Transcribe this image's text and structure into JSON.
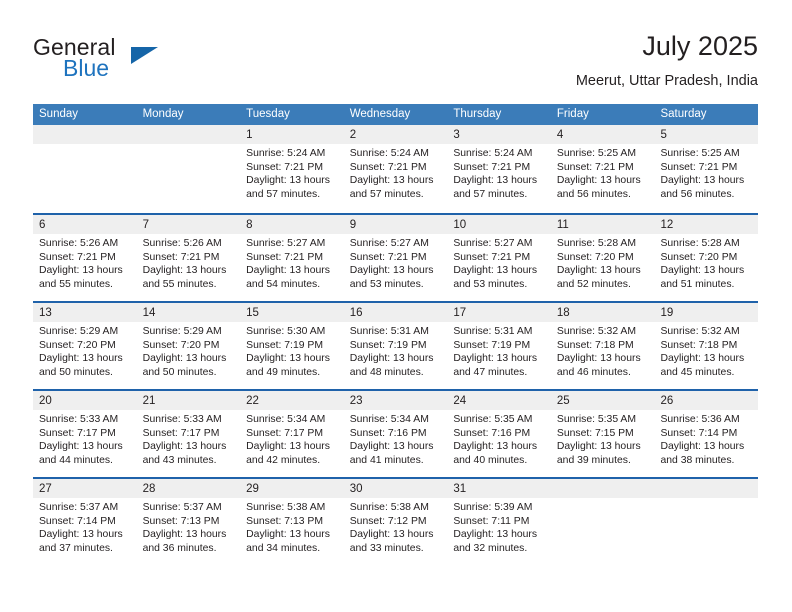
{
  "brand": {
    "name_top": "General",
    "name_bottom": "Blue",
    "triangle_icon": "brand-triangle-icon",
    "accent_color": "#1e73be"
  },
  "header": {
    "title": "July 2025",
    "subtitle": "Meerut, Uttar Pradesh, India"
  },
  "theme": {
    "header_blue": "#3b7cb9",
    "rule_blue": "#1f62aa",
    "day_band_gray": "#efefef",
    "text_color": "#231f20"
  },
  "calendar": {
    "weekdays": [
      "Sunday",
      "Monday",
      "Tuesday",
      "Wednesday",
      "Thursday",
      "Friday",
      "Saturday"
    ],
    "weeks": [
      [
        {
          "day": "",
          "sunrise": "",
          "sunset": "",
          "daylight": "",
          "empty": true
        },
        {
          "day": "",
          "sunrise": "",
          "sunset": "",
          "daylight": "",
          "empty": true
        },
        {
          "day": "1",
          "sunrise": "Sunrise: 5:24 AM",
          "sunset": "Sunset: 7:21 PM",
          "daylight": "Daylight: 13 hours and 57 minutes."
        },
        {
          "day": "2",
          "sunrise": "Sunrise: 5:24 AM",
          "sunset": "Sunset: 7:21 PM",
          "daylight": "Daylight: 13 hours and 57 minutes."
        },
        {
          "day": "3",
          "sunrise": "Sunrise: 5:24 AM",
          "sunset": "Sunset: 7:21 PM",
          "daylight": "Daylight: 13 hours and 57 minutes."
        },
        {
          "day": "4",
          "sunrise": "Sunrise: 5:25 AM",
          "sunset": "Sunset: 7:21 PM",
          "daylight": "Daylight: 13 hours and 56 minutes."
        },
        {
          "day": "5",
          "sunrise": "Sunrise: 5:25 AM",
          "sunset": "Sunset: 7:21 PM",
          "daylight": "Daylight: 13 hours and 56 minutes."
        }
      ],
      [
        {
          "day": "6",
          "sunrise": "Sunrise: 5:26 AM",
          "sunset": "Sunset: 7:21 PM",
          "daylight": "Daylight: 13 hours and 55 minutes."
        },
        {
          "day": "7",
          "sunrise": "Sunrise: 5:26 AM",
          "sunset": "Sunset: 7:21 PM",
          "daylight": "Daylight: 13 hours and 55 minutes."
        },
        {
          "day": "8",
          "sunrise": "Sunrise: 5:27 AM",
          "sunset": "Sunset: 7:21 PM",
          "daylight": "Daylight: 13 hours and 54 minutes."
        },
        {
          "day": "9",
          "sunrise": "Sunrise: 5:27 AM",
          "sunset": "Sunset: 7:21 PM",
          "daylight": "Daylight: 13 hours and 53 minutes."
        },
        {
          "day": "10",
          "sunrise": "Sunrise: 5:27 AM",
          "sunset": "Sunset: 7:21 PM",
          "daylight": "Daylight: 13 hours and 53 minutes."
        },
        {
          "day": "11",
          "sunrise": "Sunrise: 5:28 AM",
          "sunset": "Sunset: 7:20 PM",
          "daylight": "Daylight: 13 hours and 52 minutes."
        },
        {
          "day": "12",
          "sunrise": "Sunrise: 5:28 AM",
          "sunset": "Sunset: 7:20 PM",
          "daylight": "Daylight: 13 hours and 51 minutes."
        }
      ],
      [
        {
          "day": "13",
          "sunrise": "Sunrise: 5:29 AM",
          "sunset": "Sunset: 7:20 PM",
          "daylight": "Daylight: 13 hours and 50 minutes."
        },
        {
          "day": "14",
          "sunrise": "Sunrise: 5:29 AM",
          "sunset": "Sunset: 7:20 PM",
          "daylight": "Daylight: 13 hours and 50 minutes."
        },
        {
          "day": "15",
          "sunrise": "Sunrise: 5:30 AM",
          "sunset": "Sunset: 7:19 PM",
          "daylight": "Daylight: 13 hours and 49 minutes."
        },
        {
          "day": "16",
          "sunrise": "Sunrise: 5:31 AM",
          "sunset": "Sunset: 7:19 PM",
          "daylight": "Daylight: 13 hours and 48 minutes."
        },
        {
          "day": "17",
          "sunrise": "Sunrise: 5:31 AM",
          "sunset": "Sunset: 7:19 PM",
          "daylight": "Daylight: 13 hours and 47 minutes."
        },
        {
          "day": "18",
          "sunrise": "Sunrise: 5:32 AM",
          "sunset": "Sunset: 7:18 PM",
          "daylight": "Daylight: 13 hours and 46 minutes."
        },
        {
          "day": "19",
          "sunrise": "Sunrise: 5:32 AM",
          "sunset": "Sunset: 7:18 PM",
          "daylight": "Daylight: 13 hours and 45 minutes."
        }
      ],
      [
        {
          "day": "20",
          "sunrise": "Sunrise: 5:33 AM",
          "sunset": "Sunset: 7:17 PM",
          "daylight": "Daylight: 13 hours and 44 minutes."
        },
        {
          "day": "21",
          "sunrise": "Sunrise: 5:33 AM",
          "sunset": "Sunset: 7:17 PM",
          "daylight": "Daylight: 13 hours and 43 minutes."
        },
        {
          "day": "22",
          "sunrise": "Sunrise: 5:34 AM",
          "sunset": "Sunset: 7:17 PM",
          "daylight": "Daylight: 13 hours and 42 minutes."
        },
        {
          "day": "23",
          "sunrise": "Sunrise: 5:34 AM",
          "sunset": "Sunset: 7:16 PM",
          "daylight": "Daylight: 13 hours and 41 minutes."
        },
        {
          "day": "24",
          "sunrise": "Sunrise: 5:35 AM",
          "sunset": "Sunset: 7:16 PM",
          "daylight": "Daylight: 13 hours and 40 minutes."
        },
        {
          "day": "25",
          "sunrise": "Sunrise: 5:35 AM",
          "sunset": "Sunset: 7:15 PM",
          "daylight": "Daylight: 13 hours and 39 minutes."
        },
        {
          "day": "26",
          "sunrise": "Sunrise: 5:36 AM",
          "sunset": "Sunset: 7:14 PM",
          "daylight": "Daylight: 13 hours and 38 minutes."
        }
      ],
      [
        {
          "day": "27",
          "sunrise": "Sunrise: 5:37 AM",
          "sunset": "Sunset: 7:14 PM",
          "daylight": "Daylight: 13 hours and 37 minutes."
        },
        {
          "day": "28",
          "sunrise": "Sunrise: 5:37 AM",
          "sunset": "Sunset: 7:13 PM",
          "daylight": "Daylight: 13 hours and 36 minutes."
        },
        {
          "day": "29",
          "sunrise": "Sunrise: 5:38 AM",
          "sunset": "Sunset: 7:13 PM",
          "daylight": "Daylight: 13 hours and 34 minutes."
        },
        {
          "day": "30",
          "sunrise": "Sunrise: 5:38 AM",
          "sunset": "Sunset: 7:12 PM",
          "daylight": "Daylight: 13 hours and 33 minutes."
        },
        {
          "day": "31",
          "sunrise": "Sunrise: 5:39 AM",
          "sunset": "Sunset: 7:11 PM",
          "daylight": "Daylight: 13 hours and 32 minutes."
        },
        {
          "day": "",
          "sunrise": "",
          "sunset": "",
          "daylight": "",
          "empty": true
        },
        {
          "day": "",
          "sunrise": "",
          "sunset": "",
          "daylight": "",
          "empty": true
        }
      ]
    ]
  }
}
